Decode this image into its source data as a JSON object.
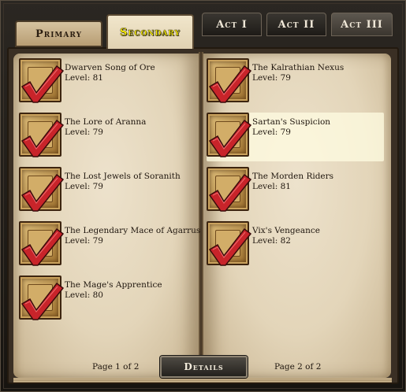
{
  "tabs": {
    "primary": "Primary",
    "secondary": "Secondary",
    "act1": "Act I",
    "act2": "Act II",
    "act3": "Act III"
  },
  "quests_left": [
    {
      "name": "Dwarven Song of Ore",
      "level": "Level: 81"
    },
    {
      "name": "The Lore of Aranna",
      "level": "Level: 79"
    },
    {
      "name": "The Lost Jewels of Soranith",
      "level": "Level: 79"
    },
    {
      "name": "The Legendary Mace of Agarrus",
      "level": "Level: 79"
    },
    {
      "name": "The Mage's Apprentice",
      "level": "Level: 80"
    }
  ],
  "quests_right": [
    {
      "name": "The Kalrathian Nexus",
      "level": "Level: 79"
    },
    {
      "name": "Sartan's Suspicion",
      "level": "Level: 79"
    },
    {
      "name": "The Morden Riders",
      "level": "Level: 81"
    },
    {
      "name": "Vix's Vengeance",
      "level": "Level: 82"
    }
  ],
  "footer": {
    "left_page": "Page 1 of 2",
    "right_page": "Page 2 of 2",
    "details": "Details"
  },
  "colors": {
    "check": "#c8242a",
    "secondary_tab_text": "#fff200"
  },
  "icons": {
    "quest_icon": "check-mark-icon"
  }
}
